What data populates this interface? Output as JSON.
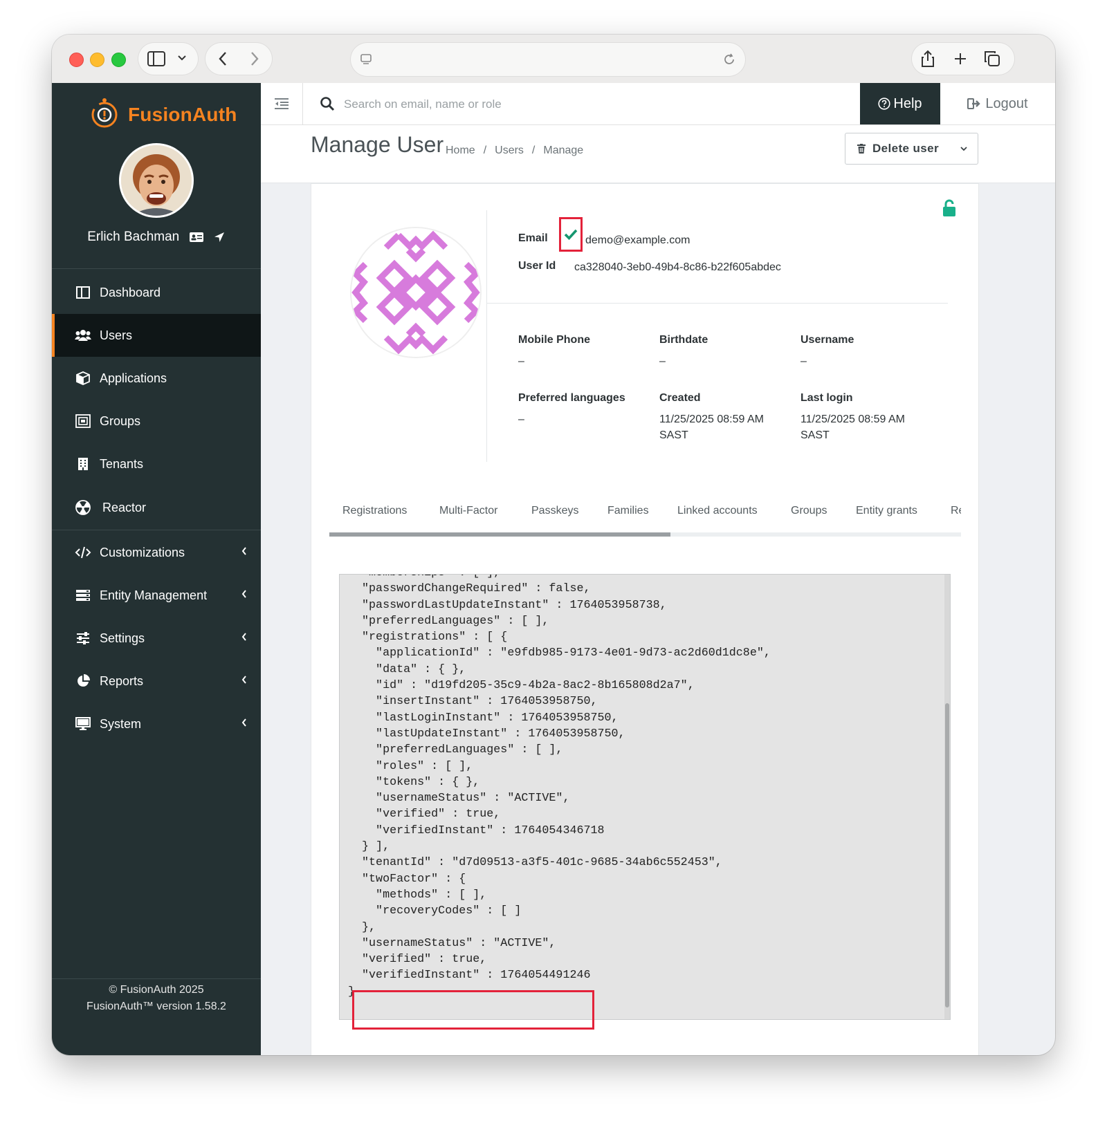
{
  "browser": {
    "address_text": ""
  },
  "app": {
    "brand_name": "FusionAuth",
    "brand_color": "#f58320",
    "sidebar_color": "#243133"
  },
  "profile": {
    "name": "Erlich Bachman"
  },
  "sidebar": {
    "items": [
      {
        "label": "Dashboard",
        "icon": "dashboard-icon"
      },
      {
        "label": "Users",
        "icon": "users-icon",
        "active": true
      },
      {
        "label": "Applications",
        "icon": "cube-icon"
      },
      {
        "label": "Groups",
        "icon": "groups-icon"
      },
      {
        "label": "Tenants",
        "icon": "building-icon"
      },
      {
        "label": "Reactor",
        "icon": "reactor-icon"
      }
    ],
    "collapsible": [
      {
        "label": "Customizations",
        "icon": "code-icon"
      },
      {
        "label": "Entity Management",
        "icon": "server-icon"
      },
      {
        "label": "Settings",
        "icon": "sliders-icon"
      },
      {
        "label": "Reports",
        "icon": "pie-chart-icon"
      },
      {
        "label": "System",
        "icon": "monitor-icon"
      }
    ],
    "footer_copyright": "© FusionAuth 2025",
    "footer_version": "FusionAuth™ version 1.58.2"
  },
  "topbar": {
    "search_placeholder": "Search on email, name or role",
    "help_label": "Help",
    "logout_label": "Logout"
  },
  "header": {
    "title": "Manage User",
    "breadcrumbs": [
      "Home",
      "Users",
      "Manage"
    ],
    "delete_label": "Delete user"
  },
  "user": {
    "email_label": "Email",
    "email": "demo@example.com",
    "user_id_label": "User Id",
    "user_id": "ca328040-3eb0-49b4-8c86-b22f605abdec",
    "fields": [
      {
        "label": "Mobile Phone",
        "value": "–"
      },
      {
        "label": "Birthdate",
        "value": "–"
      },
      {
        "label": "Username",
        "value": "–"
      },
      {
        "label": "Preferred languages",
        "value": "–"
      },
      {
        "label": "Created",
        "value": "11/25/2025 08:59 AM\nSAST"
      },
      {
        "label": "Last login",
        "value": "11/25/2025 08:59 AM\nSAST"
      }
    ]
  },
  "tabs": [
    "Registrations",
    "Multi-Factor",
    "Passkeys",
    "Families",
    "Linked accounts",
    "Groups",
    "Entity grants",
    "Re"
  ],
  "json_lines": [
    "  \"memberships\" : [ ],",
    "  \"passwordChangeRequired\" : false,",
    "  \"passwordLastUpdateInstant\" : 1764053958738,",
    "  \"preferredLanguages\" : [ ],",
    "  \"registrations\" : [ {",
    "    \"applicationId\" : \"e9fdb985-9173-4e01-9d73-ac2d60d1dc8e\",",
    "    \"data\" : { },",
    "    \"id\" : \"d19fd205-35c9-4b2a-8ac2-8b165808d2a7\",",
    "    \"insertInstant\" : 1764053958750,",
    "    \"lastLoginInstant\" : 1764053958750,",
    "    \"lastUpdateInstant\" : 1764053958750,",
    "    \"preferredLanguages\" : [ ],",
    "    \"roles\" : [ ],",
    "    \"tokens\" : { },",
    "    \"usernameStatus\" : \"ACTIVE\",",
    "    \"verified\" : true,",
    "    \"verifiedInstant\" : 1764054346718",
    "  } ],",
    "  \"tenantId\" : \"d7d09513-a3f5-401c-9685-34ab6c552453\",",
    "  \"twoFactor\" : {",
    "    \"methods\" : [ ],",
    "    \"recoveryCodes\" : [ ]",
    "  },",
    "  \"usernameStatus\" : \"ACTIVE\",",
    "  \"verified\" : true,",
    "  \"verifiedInstant\" : 1764054491246",
    "}"
  ]
}
